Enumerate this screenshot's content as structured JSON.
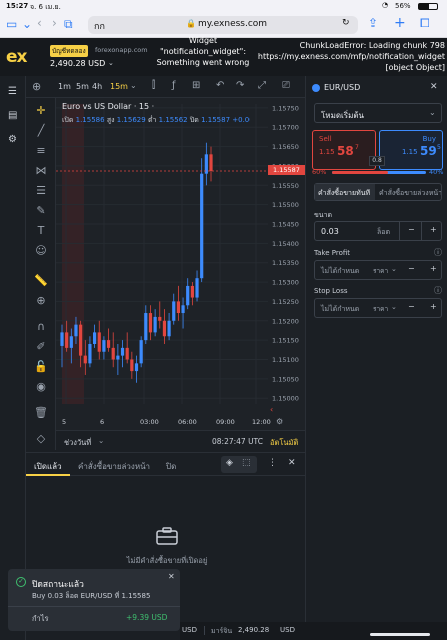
{
  "status_bar": {
    "time": "15:27",
    "date": "จ. 6 เม.ย.",
    "battery": "56%"
  },
  "browser": {
    "aa": "กก",
    "url": "my.exness.com",
    "lock_icon": "lock-icon"
  },
  "header": {
    "account_type": "บัญชีทดลอง",
    "server": "forexonapp.com",
    "balance": "2,490.28 USD",
    "widget_error": "Widget \"notification_widget\": Something went wrong",
    "chunk_error": "ChunkLoadError: Loading chunk 798 https://my.exness.com/mfp/notification_widget [object Object]"
  },
  "chart_toolbar": {
    "intervals": [
      "1m",
      "5m",
      "4h",
      "15m"
    ],
    "active_interval": "15m"
  },
  "chart": {
    "title": "Euro vs US Dollar · 15 ·",
    "ohlc": {
      "open_label": "เปิด",
      "open": "1.15586",
      "high_label": "สูง",
      "high": "1.15629",
      "low_label": "ต่ำ",
      "low": "1.15562",
      "close_label": "ปิด",
      "close": "1.15587",
      "change": "+0.00002 (+0"
    },
    "price_tag": "1.15587",
    "footer_range": "ช่วงวันที่",
    "footer_time": "08:27:47 UTC",
    "footer_auto": "อัตโนมัติ"
  },
  "chart_data": {
    "type": "candlestick",
    "yticks": [
      "1.15750",
      "1.15700",
      "1.15650",
      "1.15600",
      "1.15550",
      "1.15500",
      "1.15450",
      "1.15400",
      "1.15350",
      "1.15300",
      "1.15250",
      "1.15200",
      "1.15150",
      "1.15100",
      "1.15050",
      "1.15000"
    ],
    "xticks": [
      "5",
      "6",
      "03:00",
      "06:00",
      "09:00",
      "12:00"
    ],
    "ylim": [
      1.14985,
      1.1576
    ],
    "candles": [
      {
        "o": 1.15135,
        "h": 1.1519,
        "l": 1.1508,
        "c": 1.1517
      },
      {
        "o": 1.1517,
        "h": 1.152,
        "l": 1.1512,
        "c": 1.1513
      },
      {
        "o": 1.1513,
        "h": 1.1518,
        "l": 1.1509,
        "c": 1.1516
      },
      {
        "o": 1.1516,
        "h": 1.1521,
        "l": 1.1514,
        "c": 1.1519
      },
      {
        "o": 1.1519,
        "h": 1.152,
        "l": 1.1508,
        "c": 1.1511
      },
      {
        "o": 1.1511,
        "h": 1.1515,
        "l": 1.1506,
        "c": 1.1509
      },
      {
        "o": 1.1509,
        "h": 1.1516,
        "l": 1.1508,
        "c": 1.1514
      },
      {
        "o": 1.1514,
        "h": 1.1519,
        "l": 1.1513,
        "c": 1.1517
      },
      {
        "o": 1.1517,
        "h": 1.152,
        "l": 1.151,
        "c": 1.1512
      },
      {
        "o": 1.1512,
        "h": 1.1516,
        "l": 1.151,
        "c": 1.1515
      },
      {
        "o": 1.1515,
        "h": 1.1518,
        "l": 1.1512,
        "c": 1.1513
      },
      {
        "o": 1.1513,
        "h": 1.1517,
        "l": 1.1508,
        "c": 1.151
      },
      {
        "o": 1.151,
        "h": 1.1514,
        "l": 1.1506,
        "c": 1.1511
      },
      {
        "o": 1.1511,
        "h": 1.1515,
        "l": 1.1508,
        "c": 1.1513
      },
      {
        "o": 1.1513,
        "h": 1.1517,
        "l": 1.1509,
        "c": 1.151
      },
      {
        "o": 1.151,
        "h": 1.1512,
        "l": 1.1505,
        "c": 1.1507
      },
      {
        "o": 1.1507,
        "h": 1.1511,
        "l": 1.1504,
        "c": 1.1509
      },
      {
        "o": 1.1509,
        "h": 1.1516,
        "l": 1.1508,
        "c": 1.1515
      },
      {
        "o": 1.1515,
        "h": 1.1524,
        "l": 1.1514,
        "c": 1.1522
      },
      {
        "o": 1.1522,
        "h": 1.1524,
        "l": 1.1515,
        "c": 1.1517
      },
      {
        "o": 1.1517,
        "h": 1.1523,
        "l": 1.1516,
        "c": 1.1521
      },
      {
        "o": 1.1521,
        "h": 1.1525,
        "l": 1.1518,
        "c": 1.152
      },
      {
        "o": 1.152,
        "h": 1.1523,
        "l": 1.1514,
        "c": 1.1516
      },
      {
        "o": 1.1516,
        "h": 1.1522,
        "l": 1.1515,
        "c": 1.152
      },
      {
        "o": 1.152,
        "h": 1.1527,
        "l": 1.1519,
        "c": 1.1525
      },
      {
        "o": 1.1525,
        "h": 1.1529,
        "l": 1.152,
        "c": 1.1522
      },
      {
        "o": 1.1522,
        "h": 1.1526,
        "l": 1.1518,
        "c": 1.1524
      },
      {
        "o": 1.1524,
        "h": 1.1531,
        "l": 1.1523,
        "c": 1.1529
      },
      {
        "o": 1.1529,
        "h": 1.153,
        "l": 1.1524,
        "c": 1.1526
      },
      {
        "o": 1.1526,
        "h": 1.1533,
        "l": 1.1525,
        "c": 1.1531
      },
      {
        "o": 1.1531,
        "h": 1.1562,
        "l": 1.153,
        "c": 1.1558
      },
      {
        "o": 1.1558,
        "h": 1.1566,
        "l": 1.1555,
        "c": 1.1563
      },
      {
        "o": 1.1563,
        "h": 1.1565,
        "l": 1.1556,
        "c": 1.15587
      }
    ]
  },
  "right_panel": {
    "symbol": "EUR/USD",
    "mode": "โหมดเริ่มต้น",
    "sell_label": "Sell",
    "sell_price_a": "1.15",
    "sell_price_b": "58",
    "sell_price_c": "7",
    "buy_label": "Buy",
    "buy_price_a": "1.15",
    "buy_price_b": "59",
    "buy_price_c": "5",
    "spread": "0.8",
    "sentiment_sell": "60%",
    "sentiment_buy": "40%",
    "order_tabs": [
      "คำสั่งซื้อขายทันที",
      "คำสั่งซื้อขายล่วงหน้า"
    ],
    "volume_label": "ขนาด",
    "volume_value": "0.03",
    "volume_unit": "ล็อต",
    "tp_label": "Take Profit",
    "tp_value": "ไม่ได้กำหนด",
    "tp_unit": "ราคา",
    "sl_label": "Stop Loss",
    "sl_value": "ไม่ได้กำหนด",
    "sl_unit": "ราคา",
    "minus": "−",
    "plus": "+"
  },
  "bottom_panel": {
    "tabs": [
      "เปิดแล้ว",
      "คำสั่งซื้อขายล่วงหน้า",
      "ปิด"
    ],
    "empty_text": "ไม่มีคำสั่งซื้อขายที่เปิดอยู่"
  },
  "toast": {
    "title": "ปิดสถานะแล้ว",
    "body": "Buy 0.03 ล็อต EUR/USD ที่ 1.15585",
    "profit_label": "กำไร",
    "profit_value": "+9.39 USD"
  },
  "footer": {
    "usd_a": "USD",
    "balance_label": "มาร์จิน",
    "balance_value": "2,490.28",
    "usd_b": "USD"
  },
  "colors": {
    "up": "#3d8bfd",
    "down": "#e2463f",
    "accent": "#f7d046",
    "bg": "#1b1f24"
  }
}
